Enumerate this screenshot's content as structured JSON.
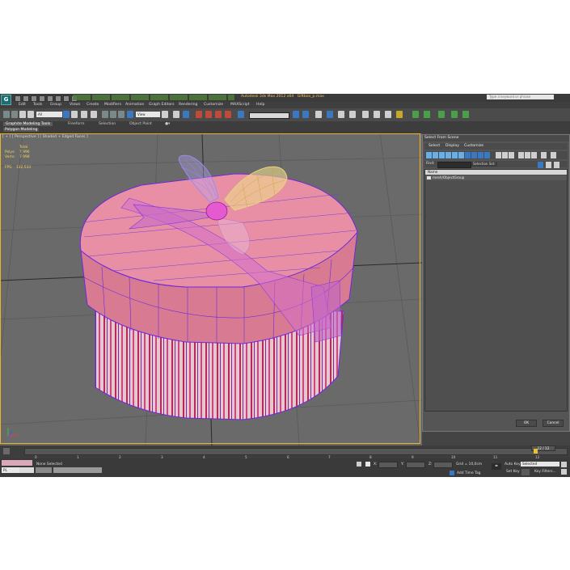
{
  "window": {
    "title": "Autodesk 3ds Max 2012 x64",
    "file": "Giftbox_p.max",
    "search_placeholder": "Type a keyword or phrase",
    "logo_letter": "G"
  },
  "menu": [
    "Edit",
    "Tools",
    "Group",
    "Views",
    "Create",
    "Modifiers",
    "Animation",
    "Graph Editors",
    "Rendering",
    "Customize",
    "MAXScript",
    "Help"
  ],
  "toolbar": {
    "filter": "All",
    "ref_coord": "View"
  },
  "ribbon": {
    "tabs": [
      "Graphite Modeling Tools",
      "Freeform",
      "Selection",
      "Object Paint"
    ],
    "panel": "Polygon Modeling"
  },
  "viewport": {
    "label": "[ + ] [ Perspective ] [ Shaded + Edged Faces ]",
    "stats": {
      "total_label": "Total",
      "polys_label": "Polys:",
      "polys_value": "7 996",
      "verts_label": "Verts:",
      "verts_value": "7 998",
      "fps_label": "FPS:",
      "fps_value": "132,533"
    }
  },
  "dialog": {
    "title": "Select From Scene",
    "tabs": [
      "Select",
      "Display",
      "Customize"
    ],
    "find_label": "Find:",
    "selection_set_label": "Selection Set:",
    "column_header": "Name",
    "items": [
      "mesh/ObjectGroup"
    ],
    "ok": "OK",
    "cancel": "Cancel"
  },
  "timeline": {
    "frame_counter": "12 / 12",
    "ticks": [
      "0",
      "1",
      "2",
      "3",
      "4",
      "5",
      "6",
      "7",
      "8",
      "9",
      "10",
      "11",
      "12"
    ]
  },
  "status": {
    "script_listener": "PL",
    "selection_text": "None Selected",
    "x_label": "X:",
    "y_label": "Y:",
    "z_label": "Z:",
    "grid": "Grid = 10,0cm",
    "auto_key": "Auto Key",
    "selected": "Selected",
    "set_key": "Set Key",
    "key_filters": "Key Filters...",
    "add_time_tag": "Add Time Tag"
  },
  "colors": {
    "viewport_bg": "#6a6a6a",
    "lid": "#e88fa6",
    "body": "#e7c6d1",
    "stripe": "#b82a5a",
    "wire": "#6a2adc",
    "bow_pink": "#e65ad0",
    "bow_gold": "#e8d27a",
    "bow_blue": "#9a8af0",
    "stat_yellow": "#f2d35a"
  }
}
